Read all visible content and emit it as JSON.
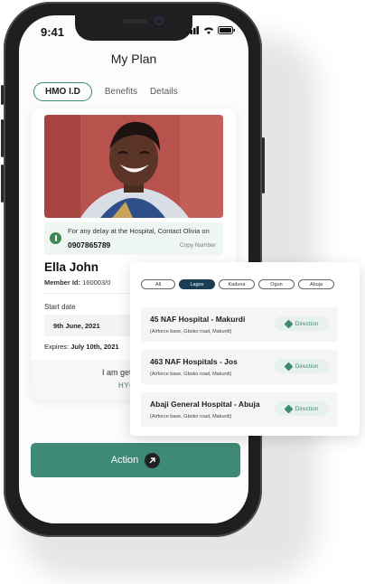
{
  "status_bar": {
    "time": "9:41",
    "icons": [
      "signal-icon",
      "wifi-icon",
      "battery-icon"
    ]
  },
  "header": {
    "title": "My Plan"
  },
  "tabs": [
    {
      "label": "HMO I.D",
      "active": true
    },
    {
      "label": "Benefits",
      "active": false
    },
    {
      "label": "Details",
      "active": false
    }
  ],
  "card": {
    "contact_text": "For any delay at the Hospital, Contact Olivia on",
    "contact_number": "0907865789",
    "copy_label": "Copy Number",
    "name": "Ella John",
    "member_label": "Member Id:",
    "member_id": "160003/0",
    "start_label": "Start date",
    "start_date": "9th June, 2021",
    "expires_label": "Expires:",
    "expires_date": "July 10th, 2021",
    "footer_text": "I am getting Tr",
    "footer_link": "HYG"
  },
  "action_button": {
    "label": "Action"
  },
  "hospital_popup": {
    "filters": [
      {
        "label": "All",
        "active": false
      },
      {
        "label": "Lagos",
        "active": true
      },
      {
        "label": "Kaduna",
        "active": false
      },
      {
        "label": "Ogun",
        "active": false
      },
      {
        "label": "Abuja",
        "active": false
      }
    ],
    "hospitals": [
      {
        "name": "45 NAF Hospital - Makurdi",
        "address": "(Airforce base, Gboko road, Makurdi)",
        "direction_label": "Direction"
      },
      {
        "name": "463 NAF Hospitals - Jos",
        "address": "(Airforce base, Gboko road, Makurdi)",
        "direction_label": "Direction"
      },
      {
        "name": "Abaji General Hospital - Abuja",
        "address": "(Airforce base, Gboko road, Makurdi)",
        "direction_label": "Direction"
      }
    ]
  },
  "colors": {
    "accent": "#3f8a76",
    "active_chip": "#1a3f55",
    "contact_bg": "#eef6f1"
  }
}
